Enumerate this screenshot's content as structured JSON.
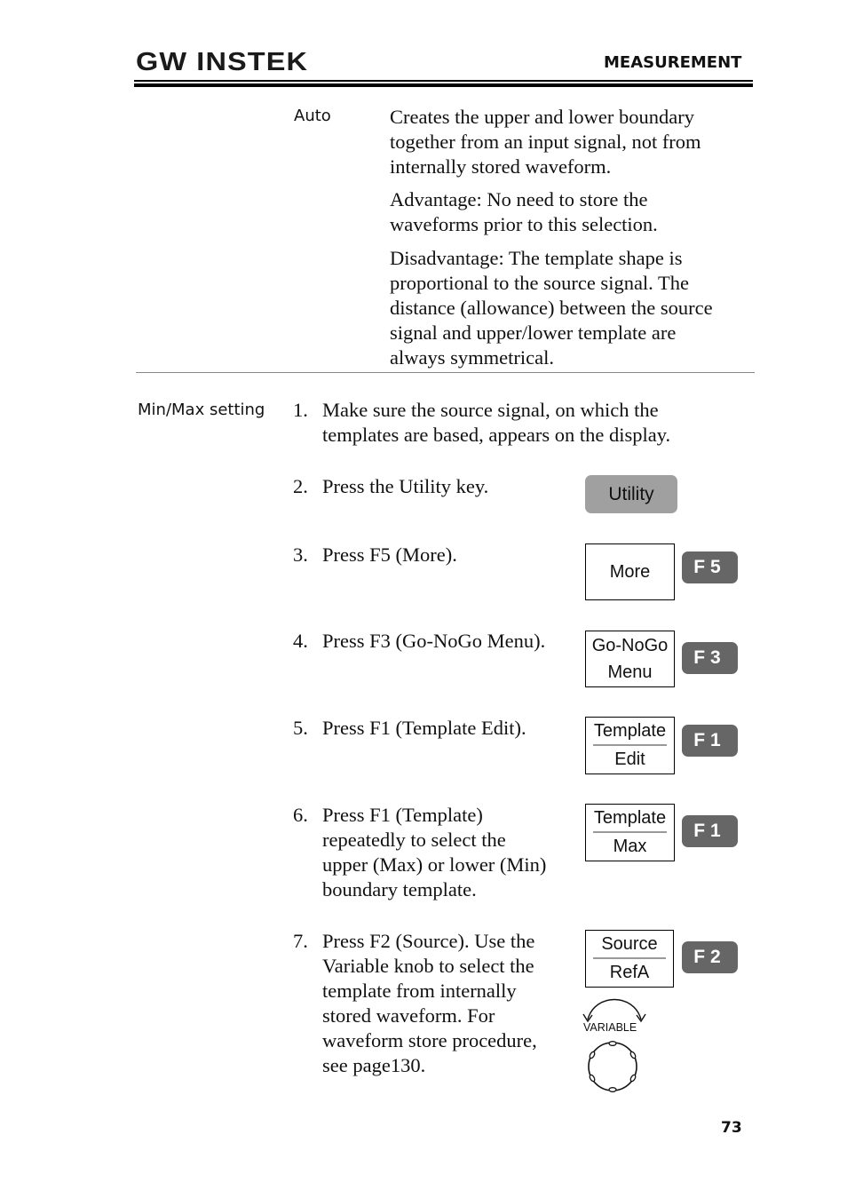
{
  "header": {
    "logo": "GW INSTEK",
    "section_title": "MEASUREMENT"
  },
  "auto": {
    "label": "Auto",
    "paragraphs": [
      [
        "Creates the upper and lower boundary",
        "together from an input signal, not from",
        "internally stored waveform."
      ],
      [
        "Advantage: No need to store the",
        "waveforms prior to this selection."
      ],
      [
        "Disadvantage: The template shape is",
        "proportional to the source signal. The",
        "distance (allowance) between the source",
        "signal and upper/lower template are",
        "always symmetrical."
      ]
    ]
  },
  "minmax": {
    "label": "Min/Max setting",
    "steps": [
      {
        "num": "1.",
        "lines": [
          "Make sure the source signal, on which the",
          "templates are based, appears on the display."
        ]
      },
      {
        "num": "2.",
        "lines": [
          "Press the Utility key."
        ]
      },
      {
        "num": "3.",
        "lines": [
          "Press F5 (More)."
        ]
      },
      {
        "num": "4.",
        "lines": [
          "Press F3 (Go-NoGo Menu)."
        ]
      },
      {
        "num": "5.",
        "lines": [
          "Press F1 (Template Edit)."
        ]
      },
      {
        "num": "6.",
        "lines": [
          "Press F1 (Template)",
          "repeatedly to select the",
          "upper (Max) or lower (Min)",
          "boundary template."
        ]
      },
      {
        "num": "7.",
        "lines": [
          "Press F2 (Source). Use the",
          "Variable knob to select the",
          "template from internally",
          "stored waveform. For",
          "waveform store procedure,",
          "see page130."
        ]
      }
    ]
  },
  "keys": {
    "utility": "Utility",
    "more": {
      "label": "More",
      "fkey": "F5"
    },
    "gonogo": {
      "top": "Go-NoGo",
      "bottom": "Menu",
      "fkey": "F3"
    },
    "template_edit": {
      "top": "Template",
      "bottom": "Edit",
      "fkey": "F1"
    },
    "template_max": {
      "top": "Template",
      "bottom": "Max",
      "fkey": "F1"
    },
    "source": {
      "top": "Source",
      "bottom": "RefA",
      "fkey": "F2"
    },
    "variable": "VARIABLE"
  },
  "footer": {
    "page_number": "73"
  }
}
